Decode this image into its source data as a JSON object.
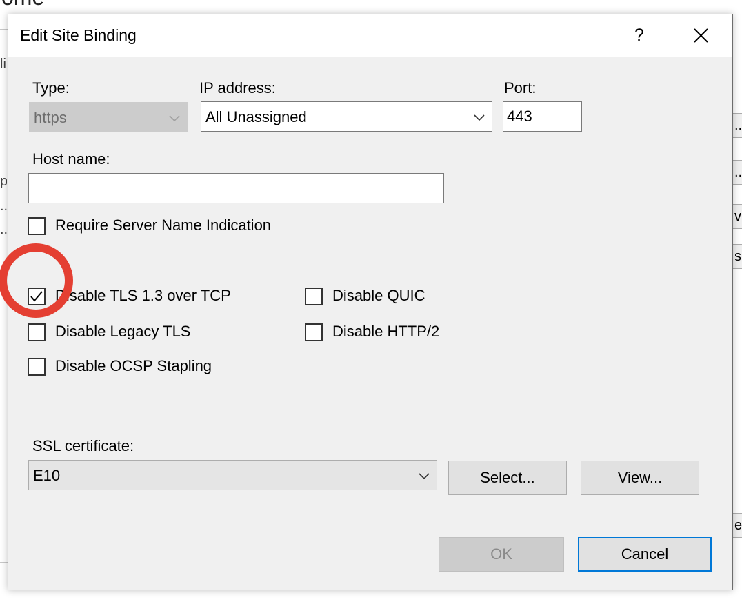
{
  "background": {
    "title_fragment": "ome",
    "left_fragments": [
      "li",
      "p",
      "..",
      "..."
    ],
    "right_button_fragments": [
      "...",
      "...",
      "v",
      "s",
      "e"
    ]
  },
  "dialog": {
    "title": "Edit Site Binding",
    "help_label": "?",
    "type": {
      "label": "Type:",
      "value": "https"
    },
    "ip_address": {
      "label": "IP address:",
      "value": "All Unassigned"
    },
    "port": {
      "label": "Port:",
      "value": "443"
    },
    "host_name": {
      "label": "Host name:",
      "value": ""
    },
    "require_sni": {
      "label": "Require Server Name Indication",
      "checked": false
    },
    "options": {
      "disable_tls13": {
        "label": "Disable TLS 1.3 over TCP",
        "checked": true
      },
      "disable_quic": {
        "label": "Disable QUIC",
        "checked": false
      },
      "disable_legacy_tls": {
        "label": "Disable Legacy TLS",
        "checked": false
      },
      "disable_http2": {
        "label": "Disable HTTP/2",
        "checked": false
      },
      "disable_ocsp": {
        "label": "Disable OCSP Stapling",
        "checked": false
      }
    },
    "ssl_certificate": {
      "label": "SSL certificate:",
      "value": "E10"
    },
    "select_button": "Select...",
    "view_button": "View...",
    "ok_button": "OK",
    "cancel_button": "Cancel"
  },
  "colors": {
    "dialog_bg": "#f0f0f0",
    "accent_focus": "#0078d7",
    "highlight_ring": "#e43f32"
  },
  "icons": [
    "chevron-down-icon",
    "close-icon",
    "checkmark-icon"
  ]
}
